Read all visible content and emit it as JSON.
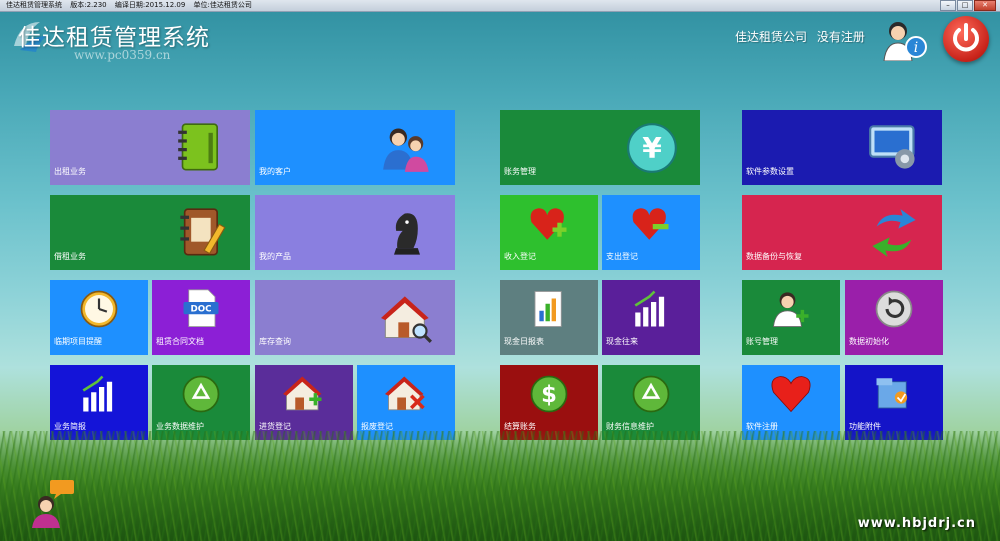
{
  "titlebar": {
    "app": "佳达租赁管理系统",
    "version": "版本:2.230",
    "compile_date": "编译日期:2015.12.09",
    "unit": "单位:佳达租赁公司"
  },
  "header": {
    "title": "佳达租赁管理系统",
    "watermark": "www.pc0359.cn",
    "company": "佳达租赁公司",
    "registration": "没有注册"
  },
  "tiles": [
    {
      "label": "出租业务",
      "color": "#8b7ed0",
      "icon": "notebook-icon"
    },
    {
      "label": "我的客户",
      "color": "#1e90ff",
      "icon": "customers-icon"
    },
    {
      "label": "借租业务",
      "color": "#1a8a3a",
      "icon": "address-book-icon"
    },
    {
      "label": "我的产品",
      "color": "#8a7fe0",
      "icon": "chess-knight-icon"
    },
    {
      "label": "临期项目提醒",
      "color": "#1e90ff",
      "icon": "clock-icon"
    },
    {
      "label": "租赁合同文档",
      "color": "#8c1fd6",
      "icon": "doc-file-icon"
    },
    {
      "label": "库存查询",
      "color": "#8b7ed0",
      "icon": "house-search-icon"
    },
    {
      "label": "业务简报",
      "color": "#1414d8",
      "icon": "bar-chart-icon"
    },
    {
      "label": "业务数据维护",
      "color": "#1a8a3a",
      "icon": "recycle-icon"
    },
    {
      "label": "进货登记",
      "color": "#5a2d9a",
      "icon": "house-add-icon"
    },
    {
      "label": "报废登记",
      "color": "#1e90ff",
      "icon": "house-delete-icon"
    },
    {
      "label": "账务管理",
      "color": "#1a8a3a",
      "icon": "yen-icon"
    },
    {
      "label": "收入登记",
      "color": "#2ec02e",
      "icon": "heart-plus-icon"
    },
    {
      "label": "支出登记",
      "color": "#1e90ff",
      "icon": "heart-minus-icon"
    },
    {
      "label": "现金日报表",
      "color": "#5e7f80",
      "icon": "report-chart-icon"
    },
    {
      "label": "现金往来",
      "color": "#5a1f9a",
      "icon": "bar-chart-icon"
    },
    {
      "label": "结算账务",
      "color": "#9a0f0f",
      "icon": "dollar-icon"
    },
    {
      "label": "财务信息维护",
      "color": "#1a8a3a",
      "icon": "recycle-icon"
    },
    {
      "label": "软件参数设置",
      "color": "#1b1bb0",
      "icon": "settings-monitor-icon"
    },
    {
      "label": "数据备份与恢复",
      "color": "#d6254f",
      "icon": "sync-arrows-icon"
    },
    {
      "label": "账号管理",
      "color": "#1a8a3a",
      "icon": "user-add-icon"
    },
    {
      "label": "数据初始化",
      "color": "#9a1faa",
      "icon": "reset-icon"
    },
    {
      "label": "软件注册",
      "color": "#1e90ff",
      "icon": "heart-icon"
    },
    {
      "label": "功能附件",
      "color": "#1414c8",
      "icon": "attachment-icon"
    }
  ],
  "footer": {
    "site": "www.hbjdrj.cn"
  }
}
